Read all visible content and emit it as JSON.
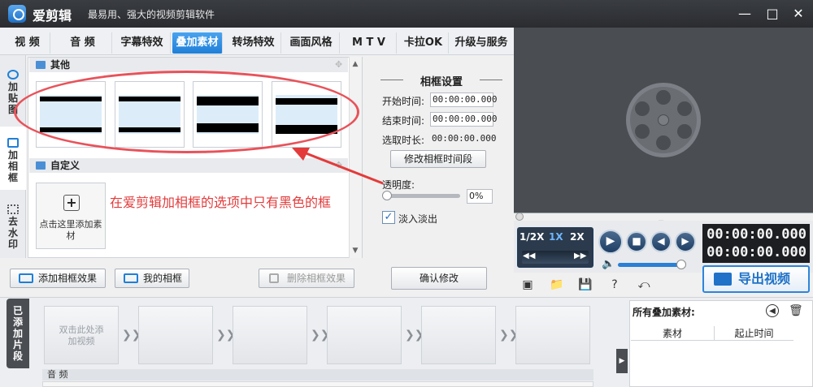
{
  "app": {
    "title": "爱剪辑",
    "slogan": "最易用、强大的视频剪辑软件"
  },
  "tabs": [
    {
      "label": "视 频"
    },
    {
      "label": "音 频"
    },
    {
      "label": "字幕特效"
    },
    {
      "label": "叠加素材"
    },
    {
      "label": "转场特效"
    },
    {
      "label": "画面风格"
    },
    {
      "label": "M T V"
    },
    {
      "label": "卡拉OK"
    },
    {
      "label": "升级与服务"
    }
  ],
  "active_tab": "叠加素材",
  "side_tabs": [
    {
      "label": "加贴图"
    },
    {
      "label": "加相框"
    },
    {
      "label": "去水印"
    }
  ],
  "sections": {
    "other": "其他",
    "custom": "自定义"
  },
  "custom_add_label": "点击这里添加素材",
  "annotation": "在爱剪辑加相框的选项中只有黑色的框",
  "bottom_buttons": {
    "add_frame": "添加相框效果",
    "my_frames": "我的相框",
    "delete_frame": "删除相框效果"
  },
  "settings": {
    "title": "相框设置",
    "start_label": "开始时间:",
    "start_value": "00:00:00.000",
    "end_label": "结束时间:",
    "end_value": "00:00:00.000",
    "duration_label": "选取时长:",
    "duration_value": "00:00:00.000",
    "modify_range_button": "修改相框时间段",
    "opacity_label": "透明度:",
    "opacity_value": "0%",
    "opacity_level": 0,
    "fade_label": "淡入淡出",
    "fade_checked": true,
    "confirm_button": "确认修改"
  },
  "player": {
    "speeds": [
      "1/2X",
      "1X",
      "2X"
    ],
    "active_speed": "1X",
    "current_time": "00:00:00.000",
    "total_time": "00:00:00.000",
    "volume_level": 0.9,
    "export_button": "导出视频"
  },
  "timeline": {
    "tab_label": "已添加片段",
    "first_clip_hint": "双击此处添加视频",
    "audio_label": "音 频"
  },
  "overlay_list": {
    "title": "所有叠加素材:",
    "columns": [
      "素材",
      "起止时间"
    ]
  },
  "icons": {
    "close": "close-icon",
    "maximize": "maximize-icon",
    "minimize": "minimize-icon"
  },
  "colors": {
    "accent": "#1f7fd8",
    "annotation": "#e33b3b",
    "titlebar": "#2f3236"
  }
}
